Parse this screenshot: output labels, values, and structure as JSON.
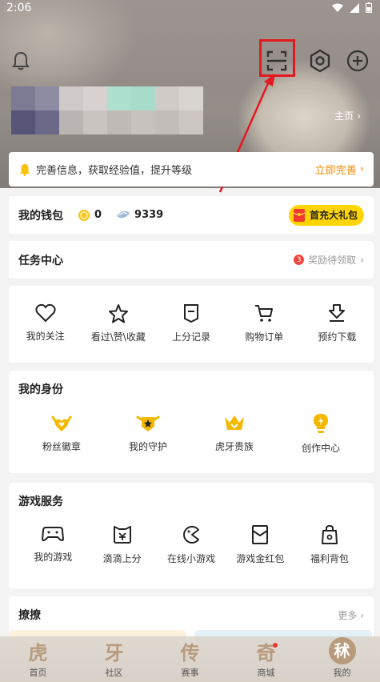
{
  "status_bar": {
    "time": "2:06"
  },
  "header": {
    "home_link": "主页"
  },
  "notice": {
    "text": "完善信息，获取经验值，提升等级",
    "cta": "立即完善"
  },
  "wallet": {
    "title": "我的钱包",
    "coins": "0",
    "diamonds": "9339",
    "gift_label": "首充大礼包"
  },
  "task": {
    "title": "任务中心",
    "badge": "3",
    "reward_text": "奖励待领取"
  },
  "quick_actions": [
    {
      "label": "我的关注",
      "icon": "heart-icon"
    },
    {
      "label": "看过\\赞\\收藏",
      "icon": "star-icon"
    },
    {
      "label": "上分记录",
      "icon": "bookmark-icon"
    },
    {
      "label": "购物订单",
      "icon": "cart-icon"
    },
    {
      "label": "预约下载",
      "icon": "download-icon"
    }
  ],
  "identity": {
    "title": "我的身份",
    "items": [
      {
        "label": "粉丝徽章",
        "icon": "fan-badge-icon"
      },
      {
        "label": "我的守护",
        "icon": "guard-icon"
      },
      {
        "label": "虎牙贵族",
        "icon": "crown-icon"
      },
      {
        "label": "创作中心",
        "icon": "bulb-icon"
      }
    ]
  },
  "games": {
    "title": "游戏服务",
    "items": [
      {
        "label": "我的游戏",
        "icon": "gamepad-icon"
      },
      {
        "label": "滴滴上分",
        "icon": "boost-icon"
      },
      {
        "label": "在线小游戏",
        "icon": "pacman-icon"
      },
      {
        "label": "游戏金红包",
        "icon": "red-packet-icon"
      },
      {
        "label": "福利背包",
        "icon": "bag-icon"
      }
    ]
  },
  "flirt": {
    "title": "撩撩",
    "more": "更多"
  },
  "tabbar": [
    {
      "glyph": "虎",
      "label": "首页"
    },
    {
      "glyph": "牙",
      "label": "社区"
    },
    {
      "glyph": "传",
      "label": "赛事"
    },
    {
      "glyph": "奇",
      "label": "商城",
      "dot": true
    },
    {
      "glyph": "秫",
      "label": "我的"
    }
  ],
  "colors": {
    "accent": "#f08a00",
    "highlight": "#e4181f",
    "gift_yellow": "#ffd400"
  }
}
